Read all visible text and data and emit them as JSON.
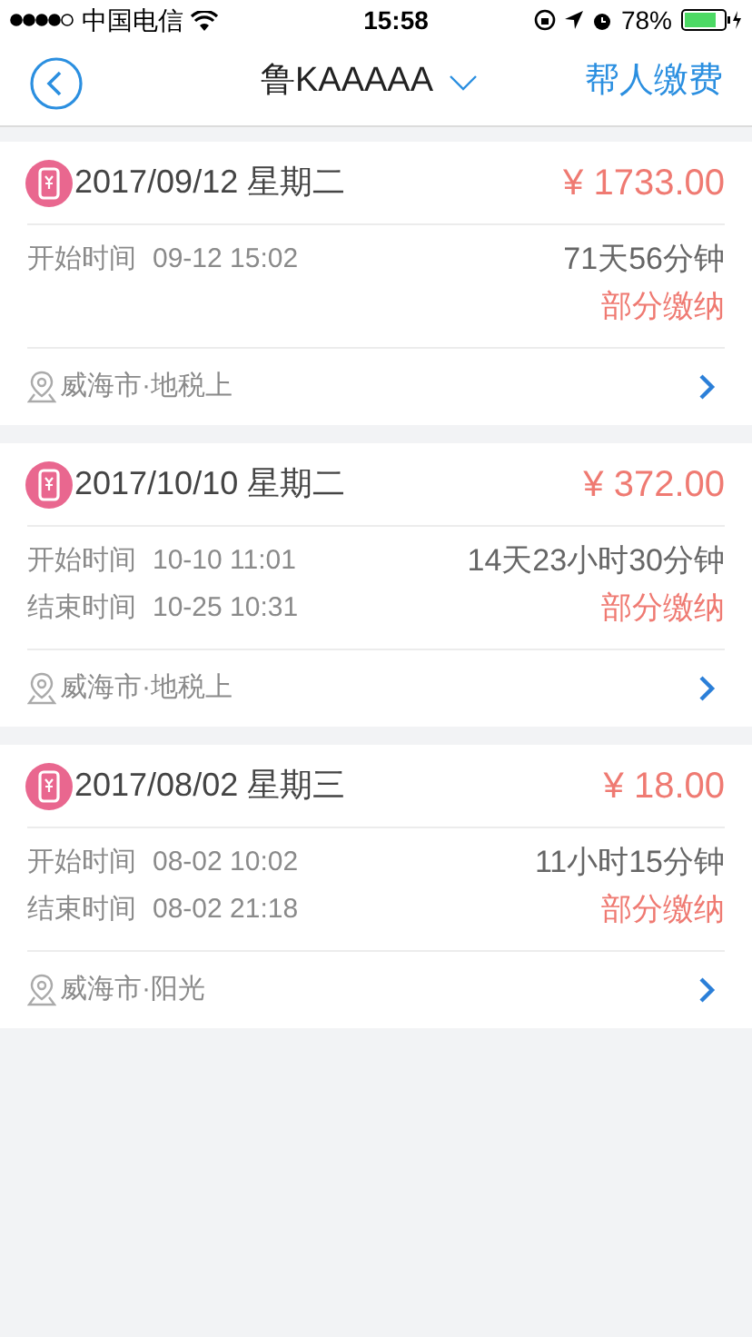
{
  "status_bar": {
    "carrier": "中国电信",
    "time": "15:58",
    "battery": "78%"
  },
  "nav": {
    "title": "鲁KAAAAA",
    "action": "帮人缴费"
  },
  "records": [
    {
      "date": "2017/09/12 星期二",
      "amount": "¥ 1733.00",
      "times": [
        {
          "label": "开始时间",
          "value": "09-12 15:02"
        }
      ],
      "duration": "71天56分钟",
      "status": "部分缴纳",
      "location": "威海市·地税上"
    },
    {
      "date": "2017/10/10 星期二",
      "amount": "¥ 372.00",
      "times": [
        {
          "label": "开始时间",
          "value": "10-10 11:01"
        },
        {
          "label": "结束时间",
          "value": "10-25 10:31"
        }
      ],
      "duration": "14天23小时30分钟",
      "status": "部分缴纳",
      "location": "威海市·地税上"
    },
    {
      "date": "2017/08/02 星期三",
      "amount": "¥ 18.00",
      "times": [
        {
          "label": "开始时间",
          "value": "08-02 10:02"
        },
        {
          "label": "结束时间",
          "value": "08-02 21:18"
        }
      ],
      "duration": "11小时15分钟",
      "status": "部分缴纳",
      "location": "威海市·阳光"
    }
  ]
}
